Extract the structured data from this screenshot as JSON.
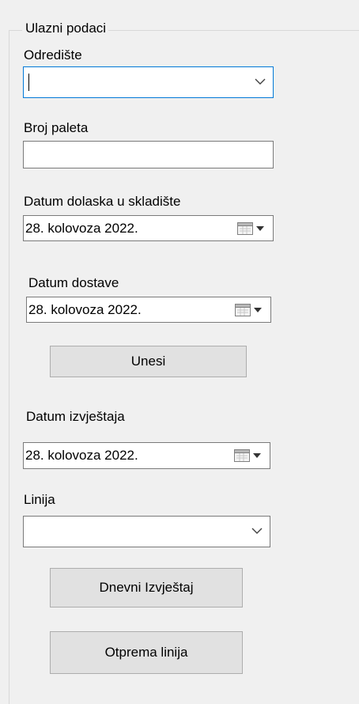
{
  "group": {
    "title": "Ulazni podaci"
  },
  "destination": {
    "label": "Odredište",
    "value": "",
    "icon": "chevron-down-icon"
  },
  "pallets": {
    "label": "Broj paleta",
    "value": ""
  },
  "arrival_date": {
    "label": "Datum dolaska u skladište",
    "value": "28. kolovoza  2022.",
    "icon": "calendar-dropdown-icon"
  },
  "delivery_date": {
    "label": "Datum dostave",
    "value": "28. kolovoza  2022.",
    "icon": "calendar-dropdown-icon"
  },
  "enter_button": {
    "label": "Unesi"
  },
  "report_date": {
    "label": "Datum izvještaja",
    "value": "28. kolovoza  2022.",
    "icon": "calendar-dropdown-icon"
  },
  "line": {
    "label": "Linija",
    "value": "",
    "icon": "chevron-down-icon"
  },
  "daily_report_button": {
    "label": "Dnevni Izvještaj"
  },
  "line_shipment_button": {
    "label": "Otprema linija"
  },
  "colors": {
    "background": "#f0f0f0",
    "focus_border": "#0078d7",
    "field_border": "#7a7a7a",
    "button_face": "#e1e1e1",
    "button_border": "#adadad"
  }
}
